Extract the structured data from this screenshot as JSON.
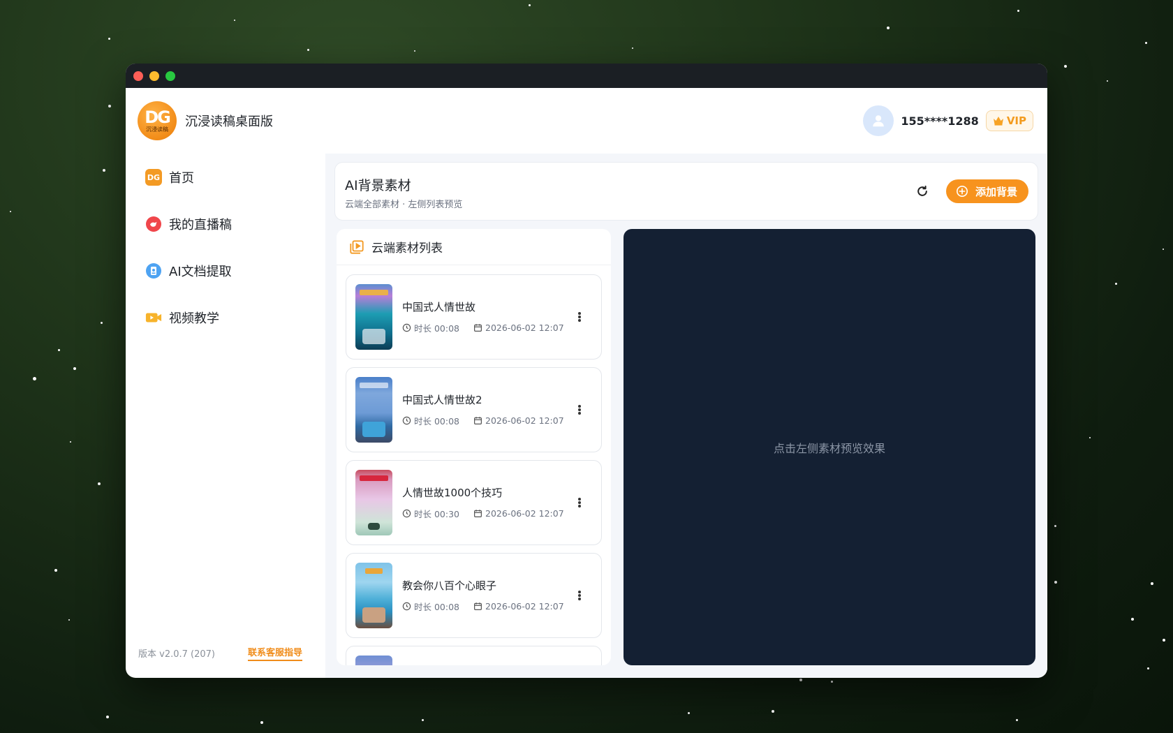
{
  "window": {
    "controls": [
      "close",
      "minimize",
      "zoom"
    ]
  },
  "brand": {
    "title": "沉浸读稿桌面版",
    "logo_text": "DG",
    "logo_caption": "沉浸读稿"
  },
  "user": {
    "phone": "155****1288",
    "badge": "VIP"
  },
  "sidebar": {
    "items": [
      {
        "label": "首页",
        "icon": "home-logo-icon"
      },
      {
        "label": "我的直播稿",
        "icon": "live-script-icon"
      },
      {
        "label": "AI文档提取",
        "icon": "ai-document-icon"
      },
      {
        "label": "视频教学",
        "icon": "video-tutorial-icon"
      }
    ],
    "version": "版本 v2.0.7 (207)",
    "support": "联系客服指导"
  },
  "header": {
    "title": "AI背景素材",
    "subtitle": "云端全部素材 · 左侧列表预览",
    "add_label": "添加背景"
  },
  "list": {
    "title": "云端素材列表",
    "items": [
      {
        "title": "中国式人情世故",
        "duration": "时长 00:08",
        "date": "2026-06-02 12:07"
      },
      {
        "title": "中国式人情世故2",
        "duration": "时长 00:08",
        "date": "2026-06-02 12:07"
      },
      {
        "title": "人情世故1000个技巧",
        "duration": "时长 00:30",
        "date": "2026-06-02 12:07"
      },
      {
        "title": "教会你八百个心眼子",
        "duration": "时长 00:08",
        "date": "2026-06-02 12:07"
      }
    ]
  },
  "preview": {
    "placeholder": "点击左侧素材预览效果"
  },
  "colors": {
    "accent": "#f7931e",
    "preview_bg": "#142033"
  }
}
